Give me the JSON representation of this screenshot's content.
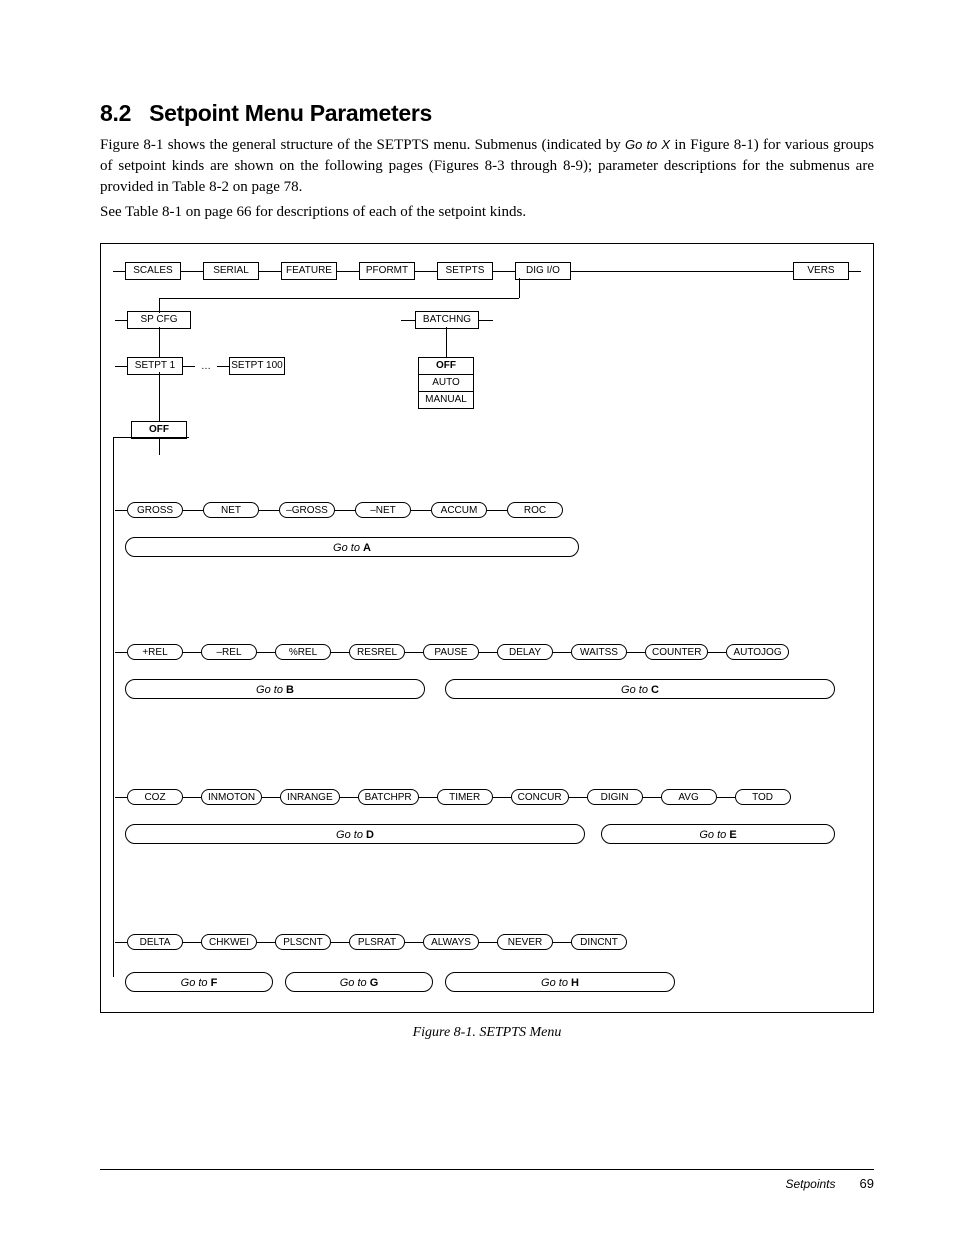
{
  "heading": {
    "num": "8.2",
    "title": "Setpoint Menu Parameters"
  },
  "para1a": "Figure 8-1 shows the general structure of the SETPTS menu. Submenus (indicated by ",
  "para1_goto": "Go to X",
  "para1b": " in Figure 8-1) for various groups of setpoint kinds are shown on the following pages (Figures 8-3 through 8-9); parameter descriptions for the submenus are provided in Table 8-2 on page 78.",
  "para2": "See Table 8-1 on page 66 for descriptions of each of the setpoint kinds.",
  "top_menu": [
    "SCALES",
    "SERIAL",
    "FEATURE",
    "PFORMT",
    "SETPTS",
    "DIG I/O",
    "VERS"
  ],
  "row2": {
    "left": "SP CFG",
    "right": "BATCHNG"
  },
  "row3": {
    "a": "SETPT 1",
    "dots": "…",
    "b": "SETPT 100"
  },
  "batch_opts": [
    "OFF",
    "AUTO",
    "MANUAL"
  ],
  "off": "OFF",
  "grpA": [
    "GROSS",
    "NET",
    "–GROSS",
    "–NET",
    "ACCUM",
    "ROC"
  ],
  "gotoA": "A",
  "grpBC": [
    "+REL",
    "–REL",
    "%REL",
    "RESREL",
    "PAUSE",
    "DELAY",
    "WAITSS",
    "COUNTER",
    "AUTOJOG"
  ],
  "gotoB": "B",
  "gotoC": "C",
  "grpDE": [
    "COZ",
    "INMOTON",
    "INRANGE",
    "BATCHPR",
    "TIMER",
    "CONCUR",
    "DIGIN",
    "AVG",
    "TOD"
  ],
  "gotoD": "D",
  "gotoE": "E",
  "grpFGH": [
    "DELTA",
    "CHKWEI",
    "PLSCNT",
    "PLSRAT",
    "ALWAYS",
    "NEVER",
    "DINCNT"
  ],
  "gotoF": "F",
  "gotoG": "G",
  "gotoH": "H",
  "caption": "Figure 8-1. SETPTS Menu",
  "goto_label": "Go to ",
  "footer": {
    "label": "Setpoints",
    "page": "69"
  }
}
